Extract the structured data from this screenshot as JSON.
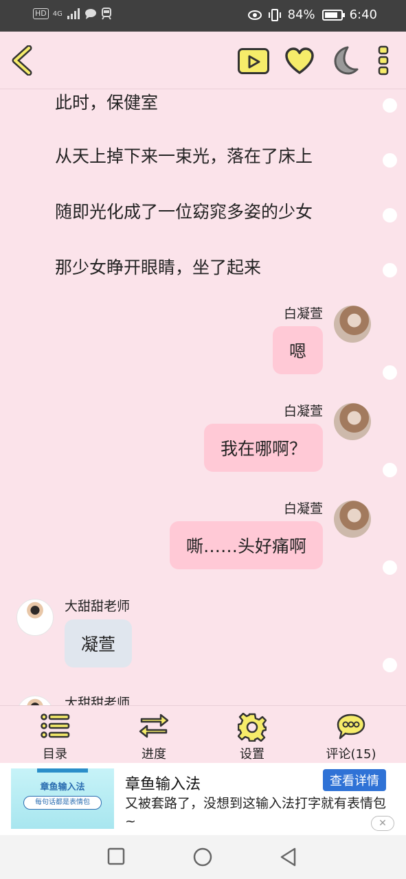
{
  "status_bar": {
    "left_icons": [
      "hd-icon",
      "4g-signal-icon",
      "chat-icon",
      "train-icon"
    ],
    "hd": "HD",
    "network": "4G",
    "battery": "84%",
    "battery_level": 0.84,
    "time": "6:40"
  },
  "toolbar": {
    "icons": [
      "back-chevron-icon",
      "play-icon",
      "heart-icon",
      "moon-icon",
      "more-dots-icon"
    ]
  },
  "story": {
    "narration": [
      "此时，保健室",
      "从天上掉下来一束光，落在了床上",
      "随即光化成了一位窈窕多姿的少女",
      "那少女睁开眼睛，坐了起来"
    ],
    "messages": [
      {
        "side": "right",
        "name": "白凝萱",
        "text": "嗯"
      },
      {
        "side": "right",
        "name": "白凝萱",
        "text": "我在哪啊？"
      },
      {
        "side": "right",
        "name": "白凝萱",
        "text": "嘶……头好痛啊"
      },
      {
        "side": "left",
        "name": "大甜甜老师",
        "text": "凝萱"
      },
      {
        "side": "left",
        "name": "大甜甜老师",
        "text": ""
      }
    ]
  },
  "bottom_nav": [
    {
      "label": "目录",
      "icon": "list-icon"
    },
    {
      "label": "进度",
      "icon": "swap-arrows-icon"
    },
    {
      "label": "设置",
      "icon": "gear-icon"
    },
    {
      "label": "评论(15)",
      "icon": "comment-bubble-icon"
    }
  ],
  "ad": {
    "image_title": "章鱼输入法",
    "image_tagline": "每句话都是表情包",
    "title": "章鱼输入法",
    "button": "查看详情",
    "description": "又被套路了，没想到这输入法打字就有表情包~",
    "close": "✕"
  },
  "system_nav": {
    "icons": [
      "recents-square-icon",
      "home-circle-icon",
      "back-triangle-icon"
    ]
  },
  "colors": {
    "background": "#fbe3ea",
    "bubble_right": "#ffc9d6",
    "bubble_left": "#e0e6ee",
    "accent_yellow": "#f6ec6a",
    "ad_button": "#2f72d6"
  }
}
